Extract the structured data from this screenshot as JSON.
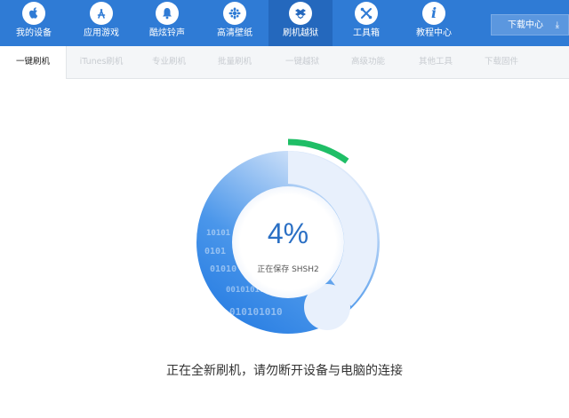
{
  "toolbar": {
    "items": [
      {
        "label": "我的设备",
        "icon": "apple-icon"
      },
      {
        "label": "应用游戏",
        "icon": "app-store-icon"
      },
      {
        "label": "酷炫铃声",
        "icon": "bell-icon"
      },
      {
        "label": "高清壁纸",
        "icon": "wallpaper-icon"
      },
      {
        "label": "刷机越狱",
        "icon": "flash-box-icon"
      },
      {
        "label": "工具箱",
        "icon": "tools-icon"
      },
      {
        "label": "教程中心",
        "icon": "info-icon"
      }
    ],
    "active_index": 4,
    "download_center": "下载中心"
  },
  "tabs": {
    "items": [
      "一键刷机",
      "iTunes刷机",
      "专业刷机",
      "批量刷机",
      "一键越狱",
      "高级功能",
      "其他工具",
      "下载固件"
    ],
    "active_index": 0
  },
  "progress": {
    "percent_text": "4%",
    "percent_value": 4,
    "status": "正在保存 SHSH2",
    "message": "正在全新刷机，请勿断开设备与电脑的连接",
    "binary_text": [
      "0101",
      "01010",
      "00101010",
      "010101010",
      "10101"
    ]
  },
  "colors": {
    "toolbar_bg": "#2f7bd5",
    "toolbar_active": "#2468bd",
    "ring_blue": "#2c86e8",
    "ring_light": "#e7effc",
    "progress_green": "#1fbe66",
    "percent_text": "#2a6fc4"
  }
}
